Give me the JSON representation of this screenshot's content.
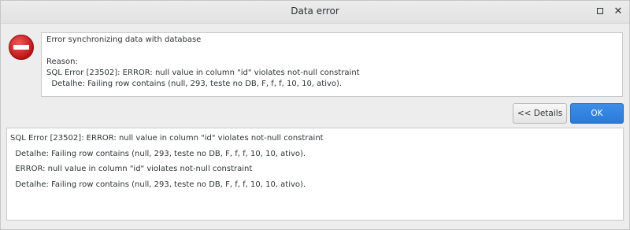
{
  "window": {
    "title": "Data error",
    "maximize_icon": "maximize-icon",
    "close_icon": "close-icon",
    "close_glyph": "✕"
  },
  "dialog": {
    "icon": "error-icon",
    "icon_color": "#cc1f1f",
    "message_lines": [
      "Error synchronizing data with database",
      "",
      "Reason:",
      "SQL Error [23502]: ERROR: null value in column \"id\" violates not-null constraint",
      "  Detalhe: Failing row contains (null, 293, teste no DB, F, f, f, 10, 10, ativo)."
    ]
  },
  "buttons": {
    "details_label": "<< Details",
    "ok_label": "OK",
    "ok_color": "#3584e4"
  },
  "details": {
    "lines": [
      "SQL Error [23502]: ERROR: null value in column \"id\" violates not-null constraint",
      "  Detalhe: Failing row contains (null, 293, teste no DB, F, f, f, 10, 10, ativo).",
      "  ERROR: null value in column \"id\" violates not-null constraint",
      "  Detalhe: Failing row contains (null, 293, teste no DB, F, f, f, 10, 10, ativo)."
    ]
  }
}
